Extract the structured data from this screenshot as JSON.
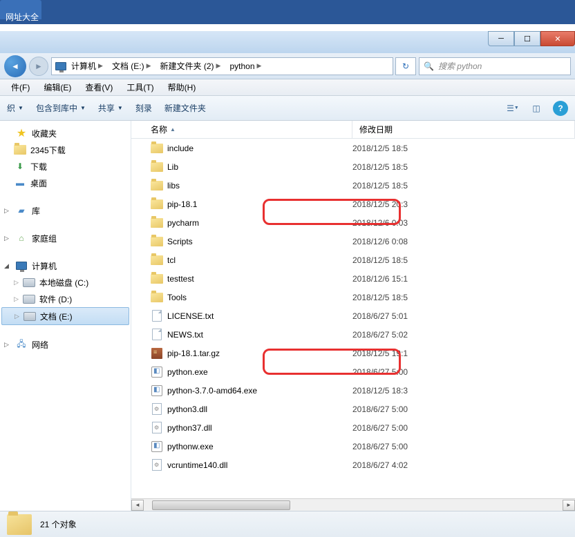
{
  "top_label": "网址大全",
  "breadcrumb": [
    "计算机",
    "文档 (E:)",
    "新建文件夹 (2)",
    "python"
  ],
  "search_placeholder": "搜索 python",
  "menu": {
    "file": "件(F)",
    "edit": "编辑(E)",
    "view": "查看(V)",
    "tools": "工具(T)",
    "help": "帮助(H)"
  },
  "toolbar": {
    "organize": "织",
    "include": "包含到库中",
    "share": "共享",
    "burn": "刻录",
    "new_folder": "新建文件夹"
  },
  "sidebar": {
    "favorites": {
      "label": "收藏夹",
      "items": [
        "2345下载",
        "下载",
        "桌面"
      ]
    },
    "libraries_label": "库",
    "homegroup_label": "家庭组",
    "computer": {
      "label": "计算机",
      "items": [
        "本地磁盘 (C:)",
        "软件 (D:)",
        "文档 (E:)"
      ]
    },
    "network_label": "网络"
  },
  "columns": {
    "name": "名称",
    "date": "修改日期"
  },
  "files": [
    {
      "name": "include",
      "type": "folder",
      "date": "2018/12/5 18:5"
    },
    {
      "name": "Lib",
      "type": "folder",
      "date": "2018/12/5 18:5"
    },
    {
      "name": "libs",
      "type": "folder",
      "date": "2018/12/5 18:5"
    },
    {
      "name": "pip-18.1",
      "type": "folder",
      "date": "2018/12/5 20:3"
    },
    {
      "name": "pycharm",
      "type": "folder",
      "date": "2018/12/6 0:03"
    },
    {
      "name": "Scripts",
      "type": "folder",
      "date": "2018/12/6 0:08"
    },
    {
      "name": "tcl",
      "type": "folder",
      "date": "2018/12/5 18:5"
    },
    {
      "name": "testtest",
      "type": "folder",
      "date": "2018/12/6 15:1"
    },
    {
      "name": "Tools",
      "type": "folder",
      "date": "2018/12/5 18:5"
    },
    {
      "name": "LICENSE.txt",
      "type": "file",
      "date": "2018/6/27 5:01"
    },
    {
      "name": "NEWS.txt",
      "type": "file",
      "date": "2018/6/27 5:02"
    },
    {
      "name": "pip-18.1.tar.gz",
      "type": "archive",
      "date": "2018/12/5 19:1"
    },
    {
      "name": "python.exe",
      "type": "exe",
      "date": "2018/6/27 5:00"
    },
    {
      "name": "python-3.7.0-amd64.exe",
      "type": "exe",
      "date": "2018/12/5 18:3"
    },
    {
      "name": "python3.dll",
      "type": "dll",
      "date": "2018/6/27 5:00"
    },
    {
      "name": "python37.dll",
      "type": "dll",
      "date": "2018/6/27 5:00"
    },
    {
      "name": "pythonw.exe",
      "type": "exe",
      "date": "2018/6/27 5:00"
    },
    {
      "name": "vcruntime140.dll",
      "type": "dll",
      "date": "2018/6/27 4:02"
    }
  ],
  "status": "21 个对象"
}
